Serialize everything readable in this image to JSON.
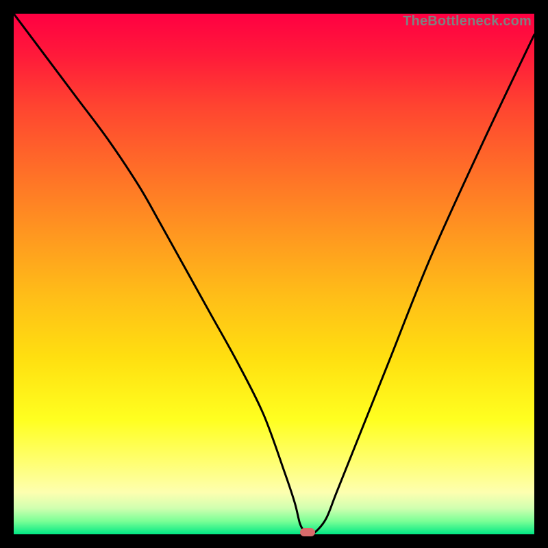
{
  "watermark": "TheBottleneck.com",
  "colors": {
    "curve_stroke": "#000000",
    "marker_fill": "#d96b6b",
    "background": "#000000"
  },
  "chart_data": {
    "type": "line",
    "title": "",
    "xlabel": "",
    "ylabel": "",
    "xlim": [
      0,
      100
    ],
    "ylim": [
      0,
      100
    ],
    "grid": false,
    "legend": false,
    "series": [
      {
        "name": "bottleneck-curve",
        "x": [
          0,
          6,
          12,
          18,
          24,
          28,
          33,
          38,
          43,
          48,
          52,
          54,
          55,
          56,
          57,
          58,
          60,
          62,
          66,
          72,
          80,
          90,
          100
        ],
        "y": [
          100,
          92,
          84,
          76,
          67,
          60,
          51,
          42,
          33,
          23,
          12,
          6,
          2,
          0.5,
          0.3,
          0.5,
          3,
          8,
          18,
          33,
          53,
          75,
          96
        ]
      }
    ],
    "marker": {
      "x": 56.5,
      "y": 0.4
    },
    "gradient_stops": [
      {
        "pos": 0,
        "color": "#ff0042"
      },
      {
        "pos": 0.5,
        "color": "#ffbd18"
      },
      {
        "pos": 0.8,
        "color": "#ffff40"
      },
      {
        "pos": 1.0,
        "color": "#00e884"
      }
    ]
  }
}
